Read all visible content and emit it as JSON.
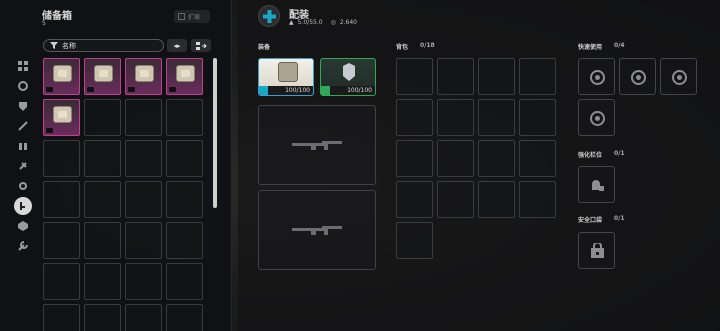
{
  "storage": {
    "title": "储备箱",
    "count": "5",
    "expand_label": "扩展",
    "search_placeholder": "名称"
  },
  "equip_header": {
    "title": "配装",
    "weight": "5.0/55.0",
    "money": "2.640"
  },
  "loadout": {
    "label": "装备",
    "slot1_durability": "100/100",
    "slot2_durability": "100/100"
  },
  "backpack": {
    "label": "背包",
    "count": "0/18"
  },
  "quickuse": {
    "label": "快速使用",
    "count": "0/4"
  },
  "enhance": {
    "label": "强化栏位",
    "count": "0/1"
  },
  "safe_pocket": {
    "label": "安全口袋",
    "count": "0/1"
  },
  "colors": {
    "accent": "#1aa7c8",
    "rarity_epic": "#c04090",
    "rarity_green": "#2fa85a"
  }
}
